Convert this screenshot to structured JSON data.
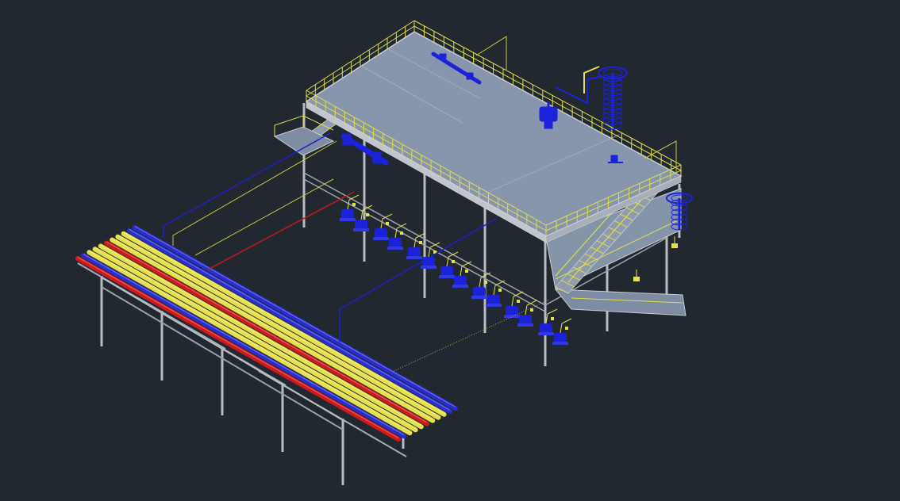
{
  "viewport": {
    "background": "#212830"
  },
  "palette": {
    "deck": "#8796ad",
    "deck_edge": "#c9cdd3",
    "steel": "#b9bdc2",
    "handrail": "#e0dc4a",
    "pipe_yellow": "#e6e04a",
    "pipe_blue": "#2a2ed0",
    "pipe_red": "#d01a1a",
    "equipment_blue": "#1c22d8",
    "leader_yellow": "#c8c640",
    "leader_blue": "#1a22c8",
    "leader_red": "#c81818"
  },
  "model": {
    "components": [
      {
        "name": "elevated-platform",
        "icon": "platform-deck-icon"
      },
      {
        "name": "pipe-rack",
        "icon": "pipe-rack-icon"
      },
      {
        "name": "pump-row",
        "icon": "pump-icon"
      },
      {
        "name": "access-stair",
        "icon": "stair-icon"
      },
      {
        "name": "spiral-stair",
        "icon": "spiral-stair-icon"
      },
      {
        "name": "deck-vessel",
        "icon": "vessel-icon"
      }
    ]
  }
}
